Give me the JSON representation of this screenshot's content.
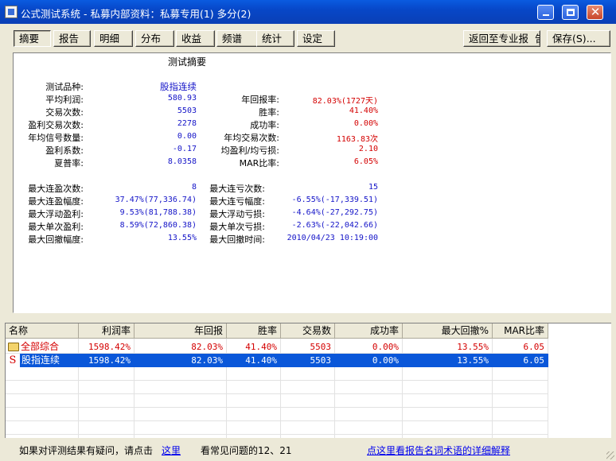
{
  "window": {
    "title": "公式测试系统 - 私募内部资料：私募专用(1) 多分(2)"
  },
  "tabs": [
    "摘要",
    "报告",
    "明细",
    "分布",
    "收益",
    "频谱",
    "统计",
    "设定"
  ],
  "toolbar": {
    "back_label": "返回至专业报",
    "back_suffix": "告",
    "save_label": "保存(S)..."
  },
  "summary": {
    "title": "测试摘要",
    "product_label": "测试品种:",
    "product_value": "股指连续",
    "left_stats": [
      {
        "label": "平均利润:",
        "value": "580.93"
      },
      {
        "label": "交易次数:",
        "value": "5503"
      },
      {
        "label": "盈利交易次数:",
        "value": "2278"
      },
      {
        "label": "年均信号数量:",
        "value": "0.00"
      },
      {
        "label": "盈利系数:",
        "value": "-0.17"
      },
      {
        "label": "夏普率:",
        "value": "8.0358"
      }
    ],
    "right_stats": [
      {
        "label": "年回报率:",
        "value": "82.03%(1727天)"
      },
      {
        "label": "胜率:",
        "value": "41.40%"
      },
      {
        "label": "成功率:",
        "value": "0.00%"
      },
      {
        "label": "年均交易次数:",
        "value": "1163.83次"
      },
      {
        "label": "均盈利/均亏损:",
        "value": "2.10"
      },
      {
        "label": "MAR比率:",
        "value": "6.05%"
      }
    ],
    "left_extremes": [
      {
        "label": "最大连盈次数:",
        "value": "8"
      },
      {
        "label": "最大连盈幅度:",
        "value": "37.47%(77,336.74)"
      },
      {
        "label": "最大浮动盈利:",
        "value": "9.53%(81,788.38)"
      },
      {
        "label": "最大单次盈利:",
        "value": "8.59%(72,860.38)"
      },
      {
        "label": "最大回撤幅度:",
        "value": "13.55%"
      }
    ],
    "right_extremes": [
      {
        "label": "最大连亏次数:",
        "value": "15"
      },
      {
        "label": "最大连亏幅度:",
        "value": "-6.55%(-17,339.51)"
      },
      {
        "label": "最大浮动亏损:",
        "value": "-4.64%(-27,292.75)"
      },
      {
        "label": "最大单次亏损:",
        "value": "-2.63%(-22,042.66)"
      },
      {
        "label": "最大回撤时间:",
        "value": "2010/04/23 10:19:00"
      }
    ]
  },
  "grid": {
    "columns": [
      "名称",
      "利润率",
      "年回报",
      "胜率",
      "交易数",
      "成功率",
      "最大回撤%",
      "MAR比率"
    ],
    "rows": [
      {
        "icon": "folder-icon",
        "name": "全部综合",
        "values": [
          "1598.42%",
          "82.03%",
          "41.40%",
          "5503",
          "0.00%",
          "13.55%",
          "6.05"
        ]
      },
      {
        "icon": "strategy-s-icon",
        "icon_text": "S",
        "name": "股指连续",
        "values": [
          "1598.42%",
          "82.03%",
          "41.40%",
          "5503",
          "0.00%",
          "13.55%",
          "6.05"
        ]
      }
    ]
  },
  "footer": {
    "question_text": "如果对评测结果有疑问，请点击",
    "here_link": "这里",
    "faq_text": "看常见问题的12、21",
    "glossary_link": "点这里看报告名词术语的详细解释"
  },
  "colors": {
    "title_bar": "#0a4fd0",
    "selection": "#0a57d9",
    "value_blue": "#1414c8",
    "value_red": "#d40000"
  }
}
